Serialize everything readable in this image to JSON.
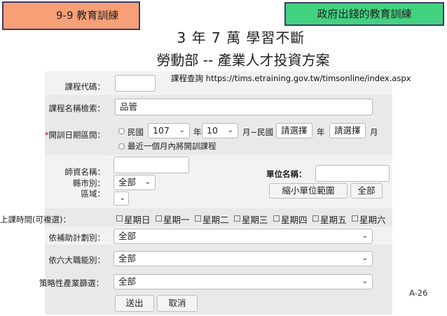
{
  "slide": {
    "tag_left": "9-9  教育訓練",
    "tag_right": "政府出錢的教育訓練",
    "title_line1": "3 年 7 萬 學習不斷",
    "title_line2": "勞動部 -- 產業人才投資方案",
    "url_text": "課程查詢 https://tims.etraining.gov.tw/timsonline/index.aspx",
    "page_number": "A-26"
  },
  "form": {
    "course_code_label": "課程代碼：",
    "course_code_value": "",
    "course_name_label": "課程名稱檢索：",
    "course_name_value": "品管",
    "date_range_label": "開訓日期區間：",
    "required_mark": "*",
    "radio_roc_label": "民國",
    "year_start": "107",
    "year_unit": "年",
    "month_start": "10",
    "month_to_roc": "月~民國",
    "year_end": "請選擇",
    "year_unit2": "年",
    "month_end": "請選擇",
    "month_unit": "月",
    "radio_recent_label": "最近一個月內將開訓課程",
    "instructor_label": "師資名稱：",
    "instructor_value": "",
    "city_label": "縣市別：",
    "city_value": "全部",
    "district_label": "區域：",
    "district_value": "",
    "unit_label": "單位名稱：",
    "unit_value": "",
    "narrow_button": "縮小單位範圍",
    "all_button": "全部",
    "class_time_label": "上課時間(可複選)：",
    "weekdays": [
      "星期日",
      "星期一",
      "星期二",
      "星期三",
      "星期四",
      "星期五",
      "星期六"
    ],
    "subsidy_label": "依補助計劃別：",
    "subsidy_value": "全部",
    "six_industries_label": "依六大職能別：",
    "six_industries_value": "全部",
    "strategic_label": "策略性產業篩選：",
    "strategic_value": "全部",
    "submit_button": "送出",
    "cancel_button": "取消"
  },
  "colors": {
    "tag_left_bg": "#f7a078",
    "tag_right_bg": "#43d27f",
    "tag_border": "#3b3b6a",
    "required": "#d40000"
  },
  "icons": {
    "select_arrow": "chevron-down-icon",
    "radio": "radio-button-icon",
    "checkbox": "checkbox-icon"
  }
}
